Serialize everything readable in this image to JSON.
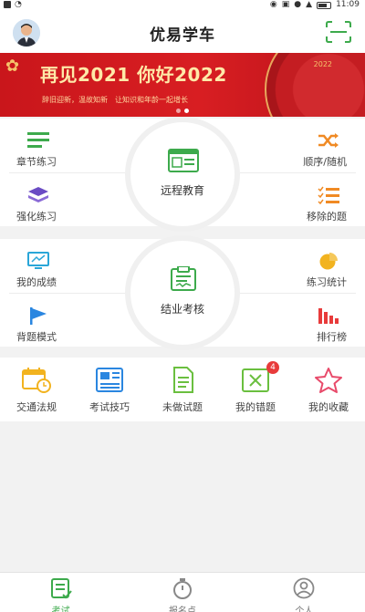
{
  "status_bar": {
    "time": "11:09"
  },
  "header": {
    "title": "优易学车",
    "avatar_icon": "avatar-photo",
    "scan_icon": "scan-icon"
  },
  "banner": {
    "headline": "再见2021 你好2022",
    "subtitle": "辞旧迎新，温故知新　让知识和年龄一起增长",
    "year_mark": "2022",
    "active_dot": 1
  },
  "section1": {
    "center": {
      "label": "远程教育",
      "icon": "remote-education-icon"
    },
    "items": [
      {
        "label": "章节练习",
        "icon": "menu-lines-icon"
      },
      {
        "label": "强化练习",
        "icon": "layers-icon"
      },
      {
        "label": "顺序/随机",
        "icon": "shuffle-icon"
      },
      {
        "label": "移除的题",
        "icon": "checklist-icon"
      }
    ]
  },
  "section2": {
    "center": {
      "label": "结业考核",
      "icon": "certificate-icon"
    },
    "items": [
      {
        "label": "我的成绩",
        "icon": "monitor-icon"
      },
      {
        "label": "背题模式",
        "icon": "flag-icon"
      },
      {
        "label": "练习统计",
        "icon": "pie-chart-icon"
      },
      {
        "label": "排行榜",
        "icon": "bar-chart-icon"
      }
    ]
  },
  "quick_actions": [
    {
      "label": "交通法规",
      "icon": "calendar-clock-icon"
    },
    {
      "label": "考试技巧",
      "icon": "newspaper-icon"
    },
    {
      "label": "未做试题",
      "icon": "document-icon"
    },
    {
      "label": "我的错题",
      "icon": "wrong-answer-icon",
      "badge": "4"
    },
    {
      "label": "我的收藏",
      "icon": "star-icon"
    }
  ],
  "tabbar": [
    {
      "label": "考试",
      "icon": "exam-icon",
      "active": true
    },
    {
      "label": "报名点",
      "icon": "stopwatch-icon",
      "active": false
    },
    {
      "label": "个人",
      "icon": "person-icon",
      "active": false
    }
  ],
  "colors": {
    "brand_green": "#3daa4c",
    "banner_red": "#d81e22",
    "accent_orange": "#f08a24",
    "accent_blue": "#2a86e0",
    "accent_purple": "#6a4bc4",
    "accent_red": "#e83b3b",
    "accent_yellow": "#f2b31f"
  }
}
